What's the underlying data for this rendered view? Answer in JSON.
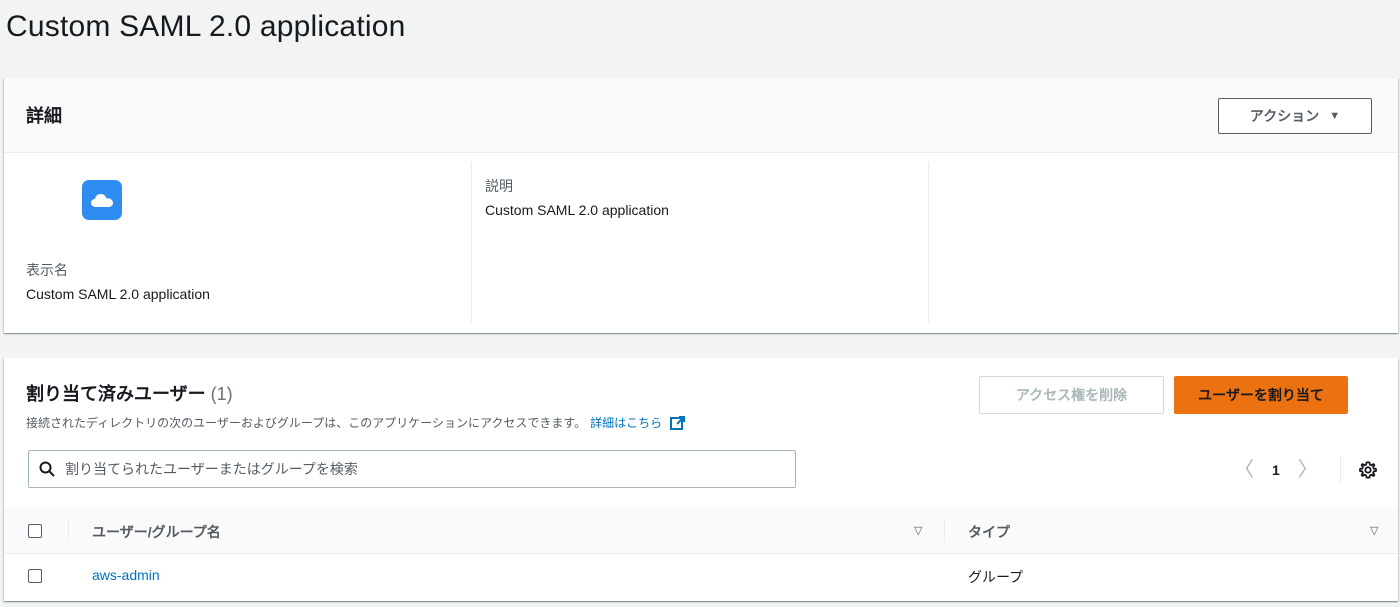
{
  "page": {
    "title": "Custom SAML 2.0 application"
  },
  "details": {
    "heading": "詳細",
    "actions_label": "アクション",
    "app_icon": "cloud-icon",
    "display_name_label": "表示名",
    "display_name_value": "Custom SAML 2.0 application",
    "description_label": "説明",
    "description_value": "Custom SAML 2.0 application"
  },
  "assigned": {
    "title": "割り当て済みユーザー",
    "count": "(1)",
    "description": "接続されたディレクトリの次のユーザーおよびグループは、このアプリケーションにアクセスできます。",
    "learn_more": "詳細はこちら",
    "remove_label": "アクセス権を削除",
    "assign_label": "ユーザーを割り当て",
    "search_placeholder": "割り当てられたユーザーまたはグループを検索",
    "page": "1",
    "columns": [
      "ユーザー/グループ名",
      "タイプ"
    ],
    "rows": [
      {
        "name": "aws-admin",
        "type": "グループ"
      }
    ]
  },
  "colors": {
    "accent": "#ec7211",
    "link": "#0073bb",
    "app_icon_bg": "#2f8df2"
  }
}
